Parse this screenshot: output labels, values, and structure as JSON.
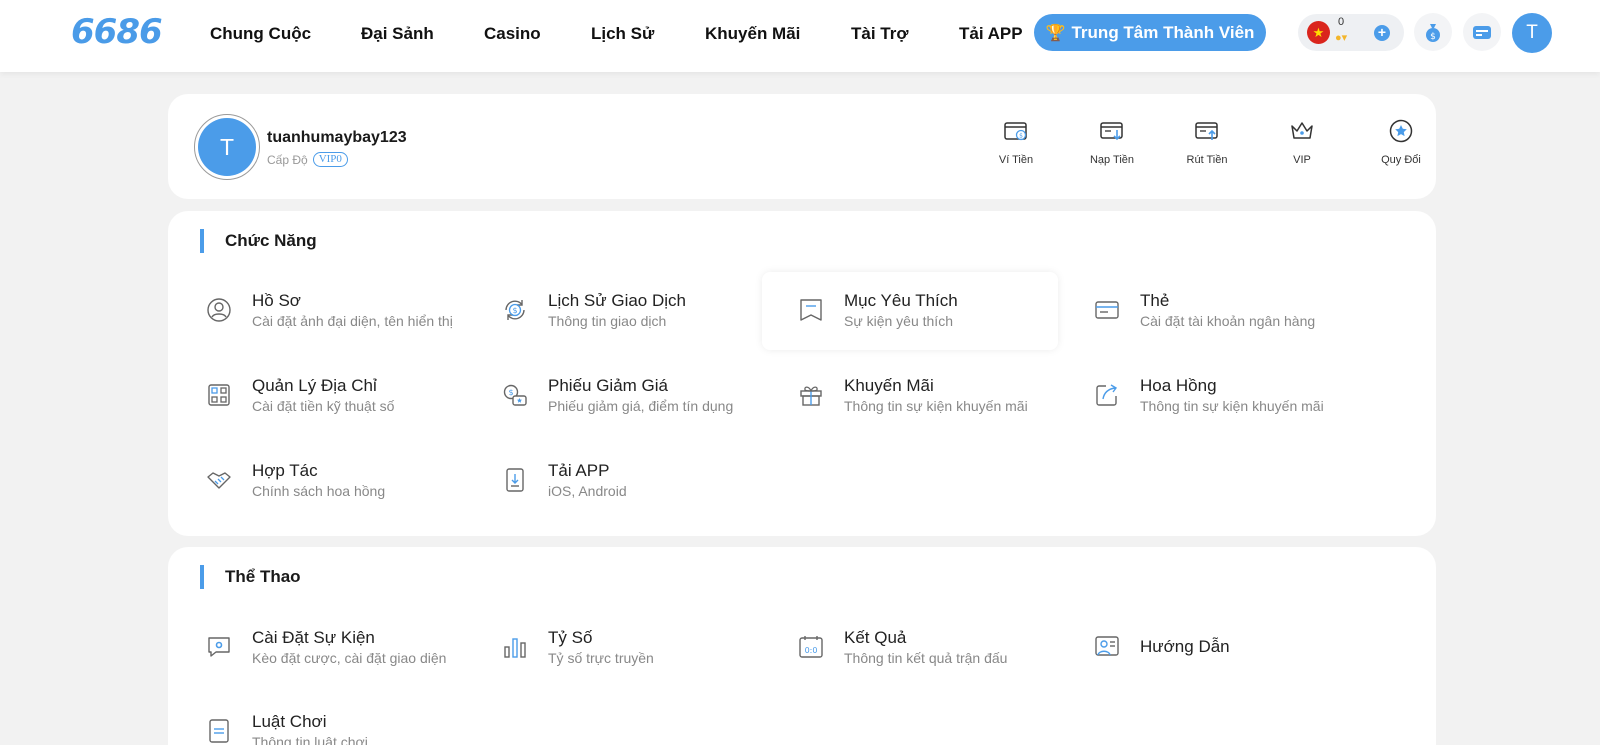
{
  "header": {
    "logo": "6686",
    "nav": [
      "Chung Cuộc",
      "Đại Sảnh",
      "Casino",
      "Lịch Sử",
      "Khuyến Mãi",
      "Tài Trợ",
      "Tải APP"
    ],
    "member_center": "Trung Tâm Thành Viên",
    "balance": "0",
    "avatar_letter": "T"
  },
  "profile": {
    "avatar_letter": "T",
    "username": "tuanhumaybay123",
    "level_label": "Cấp Độ",
    "vip": "VIP0",
    "quick_actions": [
      "Ví Tiền",
      "Nạp Tiền",
      "Rút Tiền",
      "VIP",
      "Quy Đổi"
    ]
  },
  "functions": {
    "title": "Chức Năng",
    "items": [
      {
        "title": "Hồ Sơ",
        "sub": "Cài đặt ảnh đại diện, tên hiển thị",
        "icon": "user-circle-icon"
      },
      {
        "title": "Lịch Sử Giao Dịch",
        "sub": "Thông tin giao dịch",
        "icon": "dollar-refresh-icon"
      },
      {
        "title": "Mục Yêu Thích",
        "sub": "Sự kiện yêu thích",
        "icon": "bookmark-icon"
      },
      {
        "title": "Thẻ",
        "sub": "Cài đặt tài khoản ngân hàng",
        "icon": "card-icon"
      },
      {
        "title": "Quản Lý Địa Chỉ",
        "sub": "Cài đặt tiền kỹ thuật số",
        "icon": "qr-code-icon"
      },
      {
        "title": "Phiếu Giảm Giá",
        "sub": "Phiếu giảm giá, điểm tín dụng",
        "icon": "coupon-icon"
      },
      {
        "title": "Khuyến Mãi",
        "sub": "Thông tin sự kiện khuyến mãi",
        "icon": "gift-icon"
      },
      {
        "title": "Hoa Hồng",
        "sub": "Thông tin sự kiện khuyến mãi",
        "icon": "share-arrow-icon"
      },
      {
        "title": "Hợp Tác",
        "sub": "Chính sách hoa hồng",
        "icon": "handshake-icon"
      },
      {
        "title": "Tải APP",
        "sub": "iOS, Android",
        "icon": "download-app-icon"
      }
    ]
  },
  "sports": {
    "title": "Thể Thao",
    "items": [
      {
        "title": "Cài Đặt Sự Kiện",
        "sub": "Kèo đặt cược, cài đặt giao diện",
        "icon": "chat-settings-icon"
      },
      {
        "title": "Tỷ Số",
        "sub": "Tỷ số trực truyền",
        "icon": "bar-chart-icon"
      },
      {
        "title": "Kết Quả",
        "sub": "Thông tin kết quả trận đấu",
        "icon": "scoreboard-icon"
      },
      {
        "title": "Hướng Dẫn",
        "sub": "",
        "icon": "guide-icon"
      },
      {
        "title": "Luật Chơi",
        "sub": "Thông tin luật chơi",
        "icon": "document-icon"
      }
    ]
  },
  "colors": {
    "accent": "#4b9ce9",
    "background": "#f2f2f2"
  }
}
